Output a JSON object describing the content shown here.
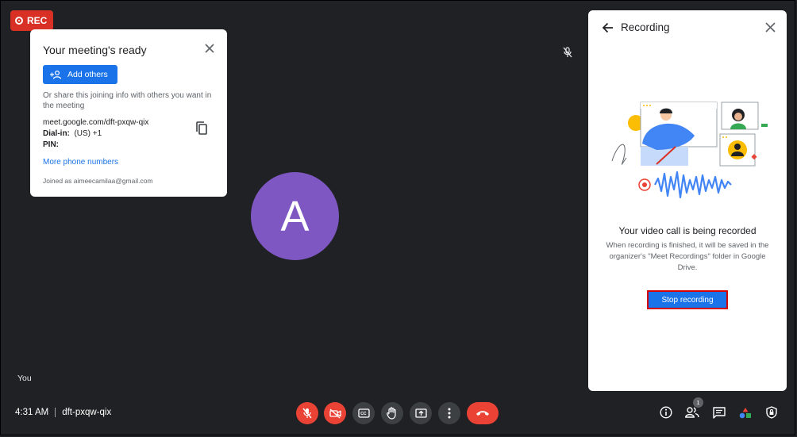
{
  "rec_badge": "REC",
  "meeting_card": {
    "title": "Your meeting's ready",
    "add_button": "Add others",
    "share_text": "Or share this joining info with others you want in the meeting",
    "link": "meet.google.com/dft-pxqw-qix",
    "dial_label": "Dial-in:",
    "dial_value": "(US) +1",
    "pin_label": "PIN:",
    "more_link": "More phone numbers",
    "joined": "Joined as aimeecamilaa@gmail.com"
  },
  "participant": {
    "initial": "A",
    "label": "You",
    "avatar_color": "#7e57c2"
  },
  "recording_panel": {
    "title": "Recording",
    "heading": "Your video call is being recorded",
    "description": "When recording is finished, it will be saved in the organizer's \"Meet Recordings\" folder in Google Drive.",
    "stop_button": "Stop recording"
  },
  "bottom_bar": {
    "time": "4:31 AM",
    "meeting_code": "dft-pxqw-qix",
    "people_count": "1",
    "controls": [
      "microphone-off-icon",
      "camera-off-icon",
      "captions-icon",
      "raise-hand-icon",
      "present-icon",
      "more-options-icon",
      "end-call-icon"
    ],
    "right_icons": [
      "info-icon",
      "people-icon",
      "chat-icon",
      "activities-icon",
      "host-controls-icon"
    ]
  },
  "colors": {
    "background": "#202124",
    "accent": "#1a73e8",
    "danger": "#ea4335"
  }
}
